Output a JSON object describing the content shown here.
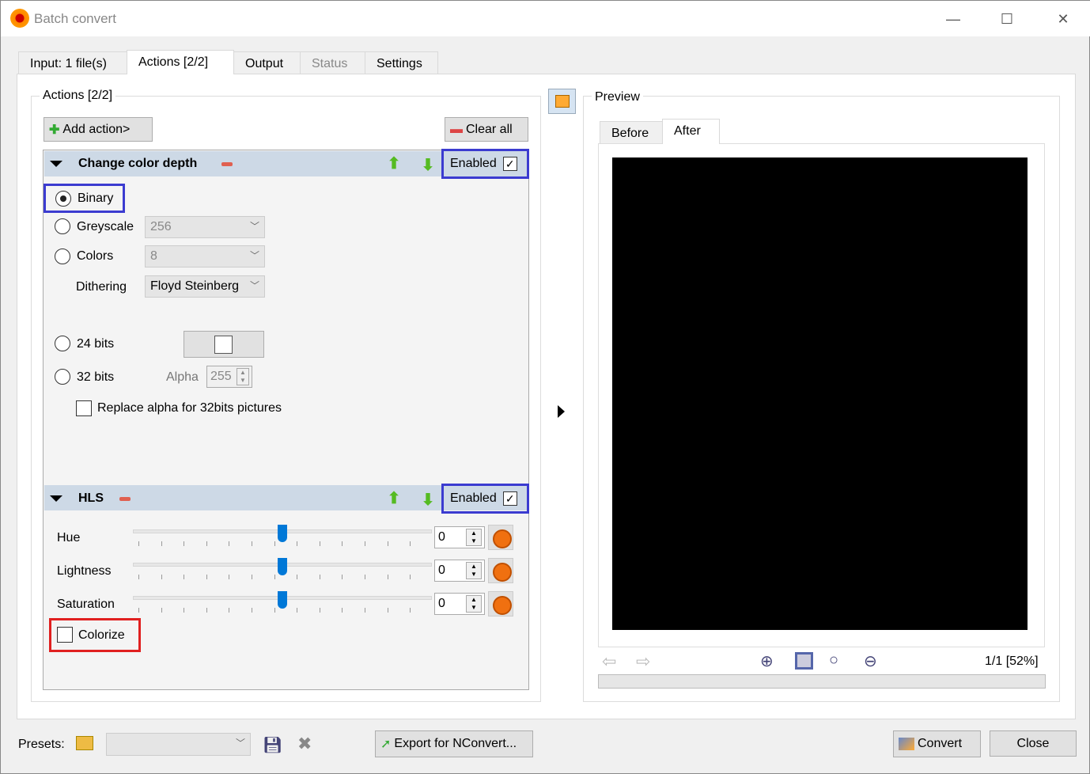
{
  "window": {
    "title": "Batch convert",
    "minimize": "—",
    "maximize": "☐",
    "close": "✕"
  },
  "tabs": [
    {
      "label": "Input: 1 file(s)"
    },
    {
      "label": "Actions [2/2]"
    },
    {
      "label": "Output"
    },
    {
      "label": "Status"
    },
    {
      "label": "Settings"
    }
  ],
  "actions": {
    "group_label": "Actions [2/2]",
    "add_action": "Add action>",
    "clear_all": "Clear all",
    "enabled_label": "Enabled",
    "check": "✓",
    "color_depth": {
      "title": "Change color depth",
      "binary": "Binary",
      "greyscale": "Greyscale",
      "greyscale_value": "256",
      "colors": "Colors",
      "colors_value": "8",
      "dithering": "Dithering",
      "dithering_value": "Floyd Steinberg",
      "bits24": "24 bits",
      "bits32": "32 bits",
      "alpha": "Alpha",
      "alpha_value": "255",
      "replace_alpha": "Replace alpha for 32bits pictures"
    },
    "hls": {
      "title": "HLS",
      "hue": "Hue",
      "hue_value": "0",
      "lightness": "Lightness",
      "lightness_value": "0",
      "saturation": "Saturation",
      "saturation_value": "0",
      "colorize": "Colorize"
    }
  },
  "preview": {
    "label": "Preview",
    "before": "Before",
    "after": "After",
    "page_zoom": "1/1 [52%]"
  },
  "footer": {
    "presets": "Presets:",
    "export": "Export for NConvert...",
    "convert": "Convert",
    "close": "Close"
  },
  "colors": {
    "highlight_blue": "#3b3bd0",
    "highlight_red": "#e02020",
    "header_bg": "#cdd9e6",
    "slider": "#0078d7"
  }
}
